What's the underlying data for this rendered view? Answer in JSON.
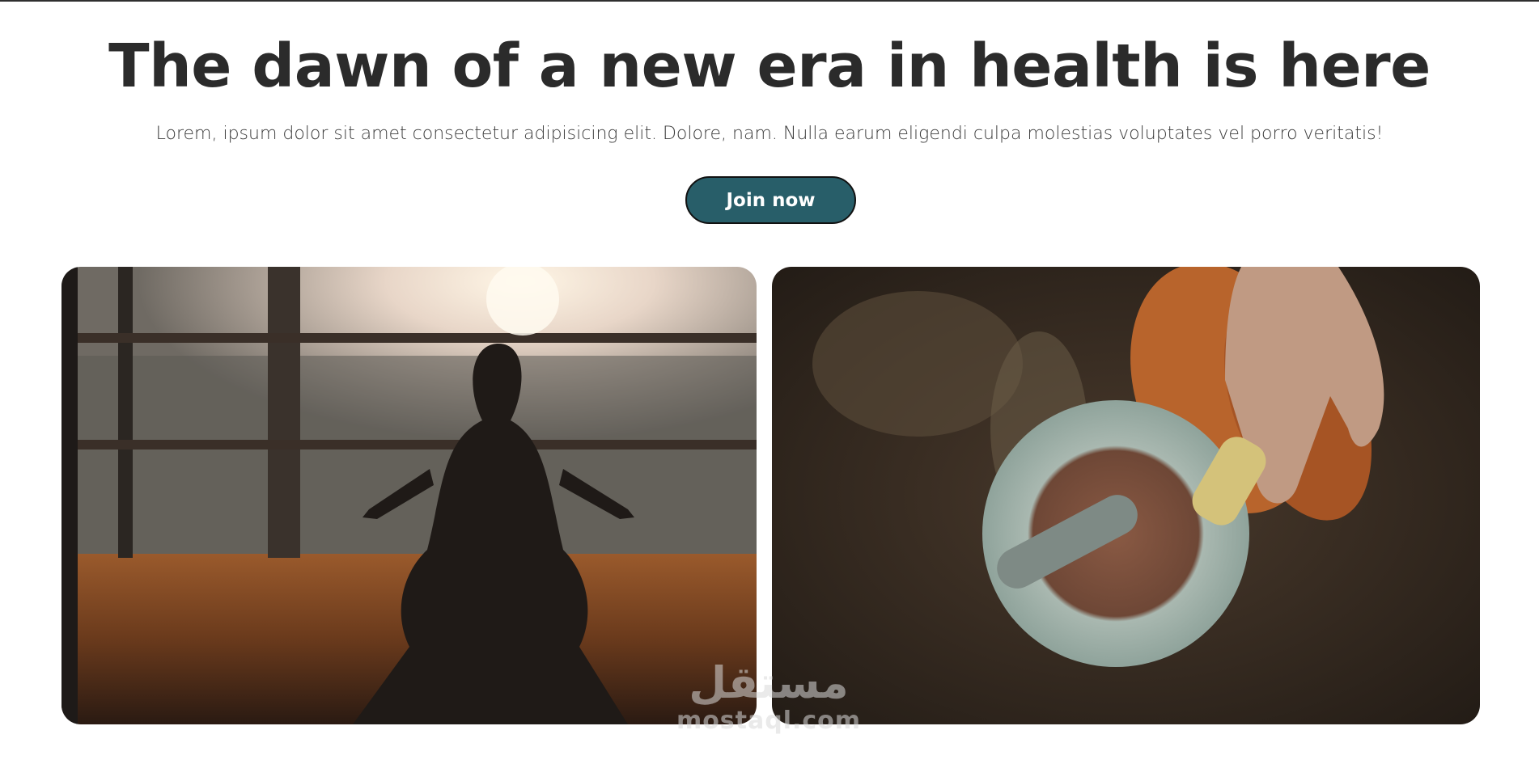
{
  "hero": {
    "title": "The dawn of a new era in health is here",
    "subtitle": "Lorem, ipsum dolor sit amet consectetur adipisicing elit. Dolore, nam. Nulla earum eligendi culpa molestias voluptates vel porro veritatis!",
    "cta_label": "Join now"
  },
  "images": [
    {
      "subject": "person meditating on wooden deck at sunrise"
    },
    {
      "subject": "mortar and pestle with herbs and oil bottle"
    }
  ],
  "watermark": {
    "arabic": "مستقل",
    "latin": "mostaql.com"
  },
  "colors": {
    "text": "#2b2b2b",
    "button_bg": "#285e69",
    "button_text": "#ffffff",
    "page_bg": "#ffffff"
  }
}
